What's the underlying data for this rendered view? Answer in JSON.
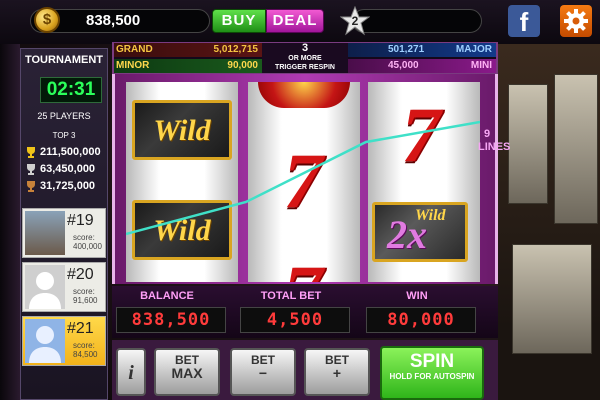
{
  "top_bar": {
    "coin_icon": "coin-icon",
    "coin_symbol": "$",
    "coins": "838,500",
    "buy_label": "BUY",
    "deal_label": "DEAL",
    "level": "2",
    "facebook_icon": "facebook-icon",
    "facebook_glyph": "f",
    "settings_icon": "gear-icon"
  },
  "jackpots": {
    "grand_label": "GRAND",
    "grand_value": "5,012,715",
    "major_label": "MAJOR",
    "major_value": "501,271",
    "minor_label": "MINOR",
    "minor_value": "90,000",
    "mini_label": "MINI",
    "mini_value": "45,000",
    "trigger_count": "3",
    "trigger_line1": "OR MORE",
    "trigger_line2": "TRIGGER RESPIN"
  },
  "tournament": {
    "title": "TOURNAMENT",
    "timer": "02:31",
    "players": "25 PLAYERS",
    "top_label": "TOP 3",
    "top_scores": [
      "211,500,000",
      "63,450,000",
      "31,725,000"
    ],
    "ranks": [
      {
        "rank": "#19",
        "score_label": "score:",
        "score": "400,000"
      },
      {
        "rank": "#20",
        "score_label": "score:",
        "score": "91,600"
      },
      {
        "rank": "#21",
        "score_label": "score:",
        "score": "84,500"
      }
    ]
  },
  "reels": {
    "wild_text": "Wild",
    "seven_text": "7",
    "multiplier_text": "2x",
    "lines_label": "9 LINES"
  },
  "meters": {
    "balance_label": "BALANCE",
    "balance": "838,500",
    "total_bet_label": "TOTAL BET",
    "total_bet": "4,500",
    "win_label": "WIN",
    "win": "80,000"
  },
  "controls": {
    "info_label": "i",
    "bet_max_l1": "BET",
    "bet_max_l2": "MAX",
    "bet_minus_l1": "BET",
    "bet_minus_l2": "−",
    "bet_plus_l1": "BET",
    "bet_plus_l2": "+",
    "spin_label": "SPIN",
    "spin_sub": "HOLD FOR AUTOSPIN"
  },
  "colors": {
    "buy": "#2fae22",
    "deal": "#d12fc4",
    "timer": "#2bff5a",
    "meter_digits": "#ff3b3b",
    "spin": "#4ccf2a"
  }
}
